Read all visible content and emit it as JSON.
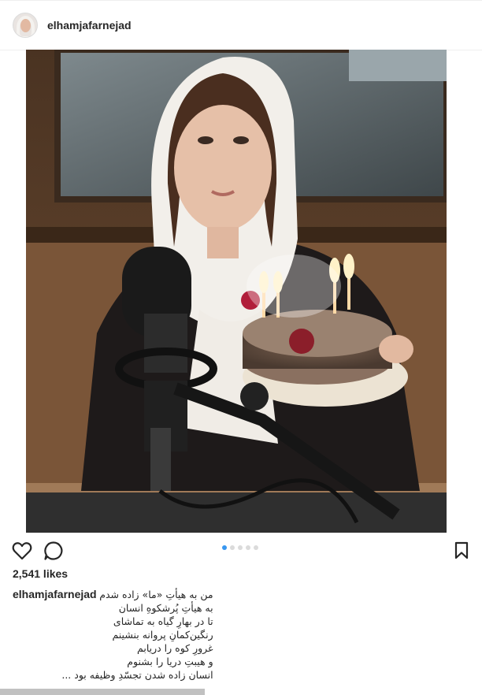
{
  "post": {
    "username": "elhamjafarnejad",
    "likes": "2,541 likes",
    "caption_username": "elhamjafarnejad",
    "caption_lines": [
      "من به هیأتِ «ما» زاده شدم",
      "به هیأتِ پُرشکوهِ انسان",
      "تا در بهارِ گیاه به تماشای",
      "رنگین‌کمانِ پروانه بنشینم",
      "غرورِ کوه را دریابم",
      "و هیبتِ دریا را بشنوم",
      "انسان زاده شدن تجسّدِ وظیفه بود ..."
    ],
    "carousel": {
      "total": 5,
      "current": 1
    }
  },
  "icons": {
    "avatar": "profile-avatar",
    "like": "heart-icon",
    "comment": "comment-icon",
    "save": "bookmark-icon"
  },
  "colors": {
    "accent": "#3897f0",
    "text": "#262626",
    "divider": "#efefef"
  }
}
